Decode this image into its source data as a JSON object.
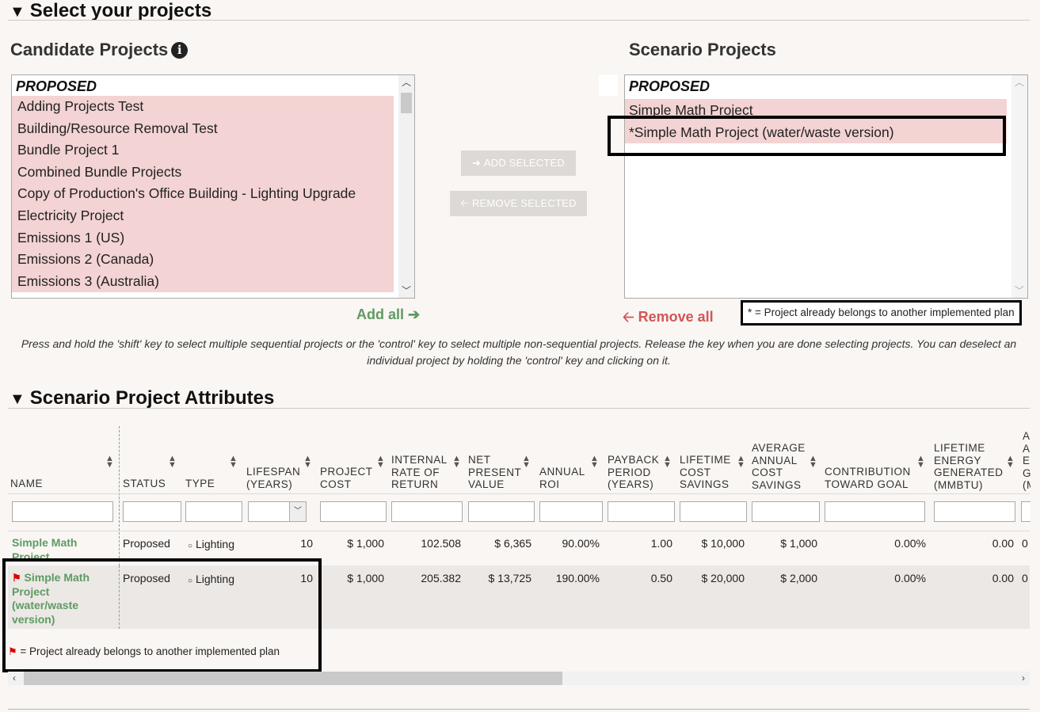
{
  "select_section": {
    "title": "Select your projects"
  },
  "candidate": {
    "title": "Candidate Projects",
    "info_icon": "i",
    "group_label": "PROPOSED",
    "items": [
      "Adding Projects Test",
      "Building/Resource Removal Test",
      "Bundle Project 1",
      "Combined Bundle Projects",
      "Copy of Production's Office Building - Lighting Upgrade",
      "Electricity Project",
      "Emissions 1 (US)",
      "Emissions 2 (Canada)",
      "Emissions 3 (Australia)"
    ],
    "add_all": "Add all"
  },
  "scenario": {
    "title": "Scenario Projects",
    "group_label": "PROPOSED",
    "items": [
      "Simple Math Project",
      "*Simple Math Project (water/waste version)"
    ],
    "remove_all": "Remove all",
    "legend": "* = Project already belongs to another implemented plan"
  },
  "buttons": {
    "add_selected": "ADD SELECTED",
    "remove_selected": "REMOVE SELECTED"
  },
  "help_text": "Press and hold the 'shift' key to select multiple sequential projects or the 'control' key to select multiple non-sequential projects. Release the key when you are done selecting projects. You can deselect an individual project by holding the 'control' key and clicking on it.",
  "attributes_section": {
    "title": "Scenario Project Attributes",
    "columns": {
      "name": "NAME",
      "status": "STATUS",
      "type": "TYPE",
      "lifespan": "LIFESPAN (YEARS)",
      "cost": "PROJECT COST",
      "irr": "INTERNAL RATE OF RETURN",
      "npv": "NET PRESENT VALUE",
      "roi": "ANNUAL ROI",
      "payback": "PAYBACK PERIOD (YEARS)",
      "lcs": "LIFETIME COST SAVINGS",
      "aacs": "AVERAGE ANNUAL COST SAVINGS",
      "goal": "CONTRIBUTION TOWARD GOAL",
      "energy": "LIFETIME ENERGY GENERATED (MMBTU)",
      "cut": "A A E G (M"
    },
    "rows": [
      {
        "name": "Simple Math Project",
        "status": "Proposed",
        "type": "Lighting",
        "lifespan": "10",
        "cost": "$ 1,000",
        "irr": "102.508",
        "npv": "$ 6,365",
        "roi": "90.00%",
        "payback": "1.00",
        "lcs": "$ 10,000",
        "aacs": "$ 1,000",
        "goal": "0.00%",
        "energy": "0.00",
        "cut": "0"
      },
      {
        "name": "Simple Math Project (water/waste version)",
        "status": "Proposed",
        "type": "Lighting",
        "lifespan": "10",
        "cost": "$ 1,000",
        "irr": "205.382",
        "npv": "$ 13,725",
        "roi": "190.00%",
        "payback": "0.50",
        "lcs": "$ 20,000",
        "aacs": "$ 2,000",
        "goal": "0.00%",
        "energy": "0.00",
        "cut": "0"
      }
    ],
    "flag_legend": "= Project already belongs to another implemented plan"
  },
  "colors": {
    "accent_green": "#5e9a62",
    "accent_red": "#d25656",
    "item_bg": "#f3d3d3",
    "page_bg": "#f9f6f3"
  }
}
